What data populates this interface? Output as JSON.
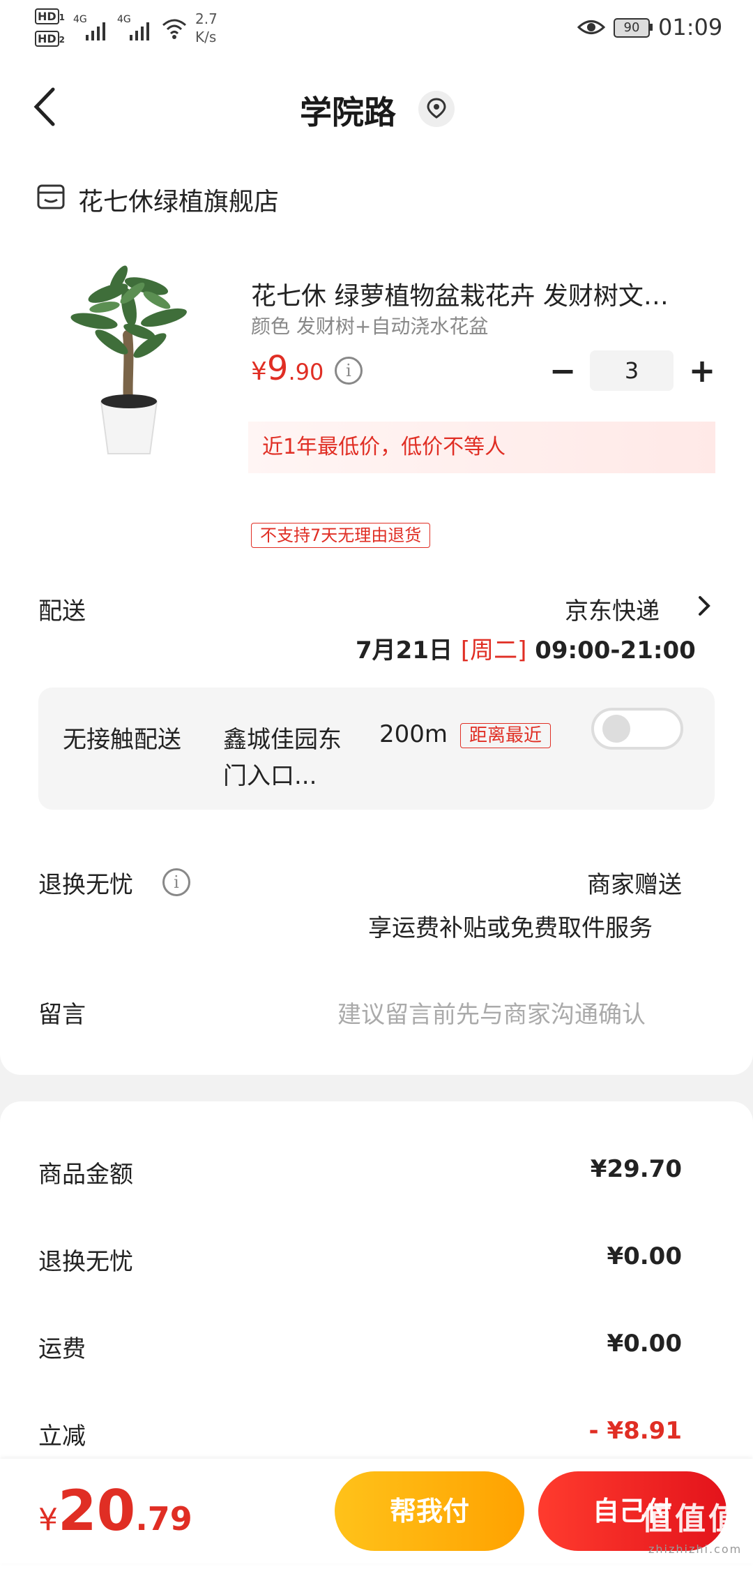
{
  "status_bar": {
    "hd1": "HD",
    "hd1_sub": "1",
    "hd2": "HD",
    "hd2_sub": "2",
    "net1": "4G",
    "net2": "4G",
    "speed_value": "2.7",
    "speed_unit": "K/s",
    "battery": "90",
    "time": "01:09"
  },
  "header": {
    "title": "学院路",
    "back_icon": "chevron-left-icon",
    "location_icon": "location-pin-icon"
  },
  "shop": {
    "name": "花七休绿植旗舰店",
    "icon": "shop-icon"
  },
  "product": {
    "title": "花七休 绿萝植物盆栽花卉 发财树文…",
    "spec": "颜色 发财树+自动浇水花盆",
    "price_symbol": "¥",
    "price_int": "9",
    "price_dec": ".90",
    "quantity": "3",
    "minus": "−",
    "plus": "+",
    "low_price_text": "近1年最低价，低价不等人",
    "no_return_tag": "不支持7天无理由退货"
  },
  "delivery": {
    "label": "配送",
    "carrier": "京东快递",
    "date": "7月21日",
    "weekday": "[周二]",
    "time_range": "09:00-21:00"
  },
  "contactless": {
    "label": "无接触配送",
    "location_line1": "鑫城佳园东",
    "location_line2": "门入口...",
    "distance": "200m",
    "nearest_tag": "距离最近",
    "enabled": false
  },
  "return_service": {
    "label": "退换无忧",
    "value_line1": "商家赠送",
    "value_line2": "享运费补贴或免费取件服务"
  },
  "message": {
    "label": "留言",
    "placeholder": "建议留言前先与商家沟通确认"
  },
  "summary": {
    "rows": [
      {
        "label": "商品金额",
        "value": "¥29.70"
      },
      {
        "label": "退换无忧",
        "value": "¥0.00"
      },
      {
        "label": "运费",
        "value": "¥0.00"
      },
      {
        "label": "立减",
        "value": "- ¥8.91"
      }
    ]
  },
  "footer": {
    "total_symbol": "¥",
    "total_int": "20",
    "total_dec": ".79",
    "help_pay_label": "帮我付",
    "self_pay_label": "自己付",
    "watermark": "值值值",
    "watermark_url": "zhizhizhi.com"
  },
  "colors": {
    "accent_red": "#e02e24",
    "button_yellow": "#ffb000",
    "button_red": "#f0201f"
  }
}
